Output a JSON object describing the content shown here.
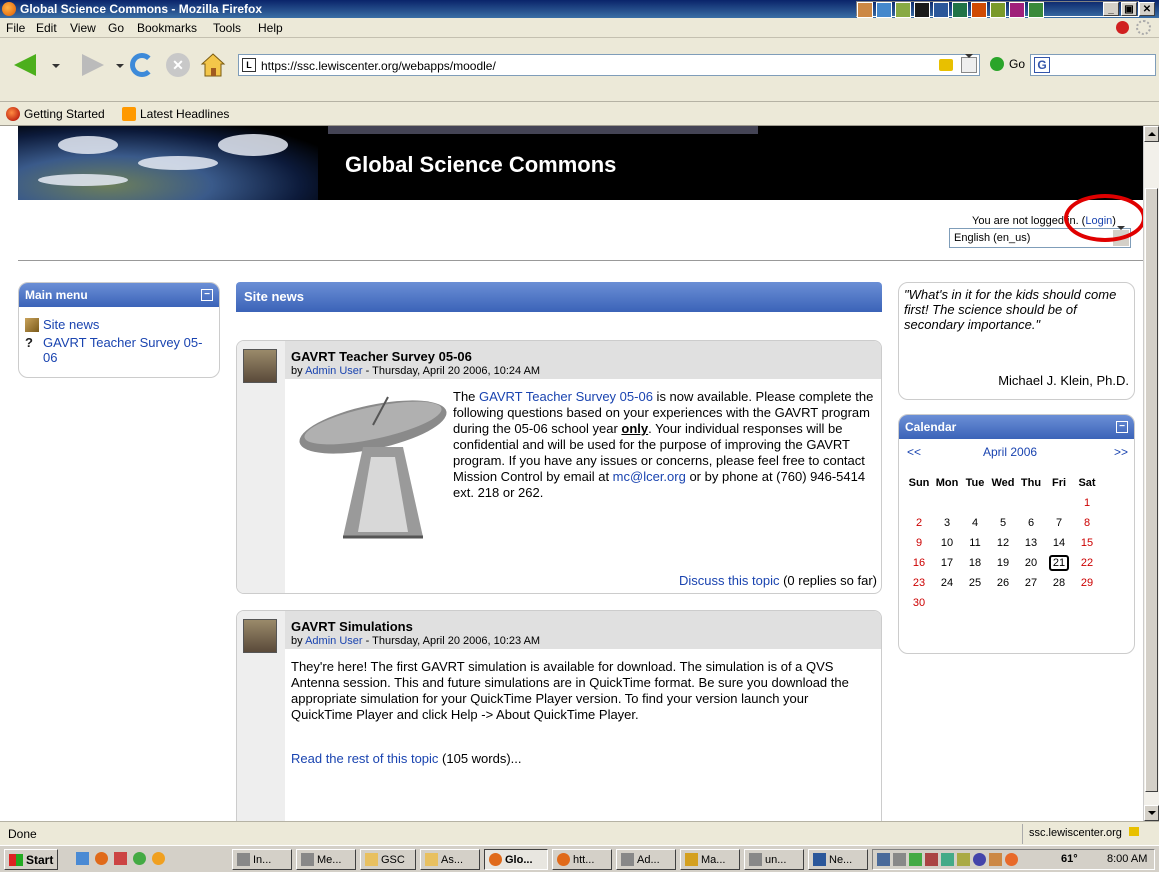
{
  "window": {
    "title": "Global Science Commons - Mozilla Firefox"
  },
  "menubar": {
    "items": [
      "File",
      "Edit",
      "View",
      "Go",
      "Bookmarks",
      "Tools",
      "Help"
    ]
  },
  "navbar": {
    "url": "https://ssc.lewiscenter.org/webapps/moodle/",
    "go_label": "Go"
  },
  "bookmarks": {
    "items": [
      "Getting Started",
      "Latest Headlines"
    ]
  },
  "header": {
    "site_title": "Global Science Commons",
    "login_prefix": "You are not logged in. (",
    "login_link": "Login",
    "login_suffix": ")",
    "language": "English (en_us)"
  },
  "main_menu": {
    "title": "Main menu",
    "items": [
      "Site news",
      "GAVRT Teacher Survey 05-06"
    ]
  },
  "site_news": {
    "title": "Site news",
    "posts": [
      {
        "title": "GAVRT Teacher Survey 05-06",
        "by_prefix": "by ",
        "author": "Admin User",
        "date": " - Thursday, April 20 2006, 10:24 AM",
        "body_pre": "The ",
        "body_link": "GAVRT Teacher Survey 05-06",
        "body_mid": " is now available. Please complete the following questions based on your experiences with the GAVRT program during the 05-06 school year ",
        "body_bold": "only",
        "body_after": ". Your individual responses will be confidential and will be used for the purpose of improving the GAVRT program. If you have any issues or concerns, please feel free to contact Mission Control by email at ",
        "email": "mc@lcer.org",
        "body_end": " or by phone at (760) 946-5414 ext. 218 or 262.",
        "discuss_link": "Discuss this topic",
        "discuss_count": " (0 replies so far)"
      },
      {
        "title": "GAVRT Simulations",
        "by_prefix": "by ",
        "author": "Admin User",
        "date": " - Thursday, April 20 2006, 10:23 AM",
        "body": "They're here! The first GAVRT simulation is available for download. The simulation is of a QVS Antenna session. This and future simulations are in QuickTime format. Be sure you download the appropriate simulation for your QuickTime Player version. To find your version launch your QuickTime Player and click Help -> About QuickTime Player.",
        "read_link": "Read the rest of this topic",
        "read_count": " (105 words)..."
      }
    ]
  },
  "quote": {
    "text": "\"What's in it for the kids should come first! The science should be of secondary importance.\"",
    "author": "Michael J. Klein, Ph.D."
  },
  "calendar": {
    "title": "Calendar",
    "prev": "<<",
    "next": ">>",
    "month": "April 2006",
    "days": [
      "Sun",
      "Mon",
      "Tue",
      "Wed",
      "Thu",
      "Fri",
      "Sat"
    ],
    "weeks": [
      [
        "",
        "",
        "",
        "",
        "",
        "",
        "1"
      ],
      [
        "2",
        "3",
        "4",
        "5",
        "6",
        "7",
        "8"
      ],
      [
        "9",
        "10",
        "11",
        "12",
        "13",
        "14",
        "15"
      ],
      [
        "16",
        "17",
        "18",
        "19",
        "20",
        "21",
        "22"
      ],
      [
        "23",
        "24",
        "25",
        "26",
        "27",
        "28",
        "29"
      ],
      [
        "30",
        "",
        "",
        "",
        "",
        "",
        ""
      ]
    ],
    "today": "21"
  },
  "statusbar": {
    "status": "Done",
    "host": "ssc.lewiscenter.org"
  },
  "taskbar": {
    "start": "Start",
    "buttons": [
      "In...",
      "Me...",
      "GSC",
      "As...",
      "Glo...",
      "htt...",
      "Ad...",
      "Ma...",
      "un...",
      "Ne..."
    ],
    "temperature": "61°",
    "clock": "8:00 AM"
  }
}
